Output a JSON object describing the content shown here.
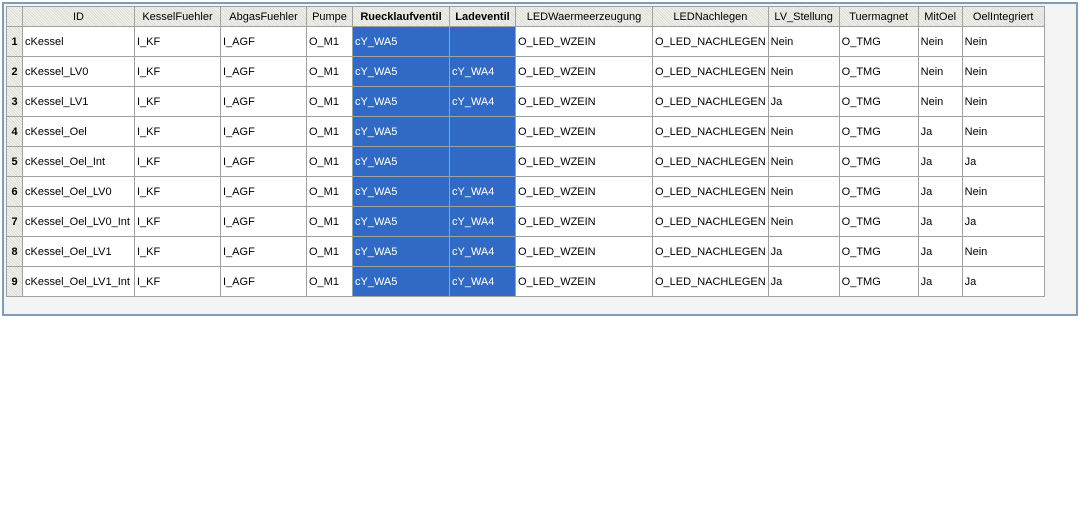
{
  "grid": {
    "columns": [
      "ID",
      "KesselFuehler",
      "AbgasFuehler",
      "Pumpe",
      "Ruecklaufventil",
      "Ladeventil",
      "LEDWaermeerzeugung",
      "LEDNachlegen",
      "LV_Stellung",
      "Tuermagnet",
      "MitOel",
      "OelIntegriert"
    ],
    "rows": [
      {
        "num": "1",
        "cells": [
          "cKessel",
          "I_KF",
          "I_AGF",
          "O_M1",
          "cY_WA5",
          "",
          "O_LED_WZEIN",
          "O_LED_NACHLEGEN",
          "Nein",
          "O_TMG",
          "Nein",
          "Nein"
        ]
      },
      {
        "num": "2",
        "cells": [
          "cKessel_LV0",
          "I_KF",
          "I_AGF",
          "O_M1",
          "cY_WA5",
          "cY_WA4",
          "O_LED_WZEIN",
          "O_LED_NACHLEGEN",
          "Nein",
          "O_TMG",
          "Nein",
          "Nein"
        ]
      },
      {
        "num": "3",
        "cells": [
          "cKessel_LV1",
          "I_KF",
          "I_AGF",
          "O_M1",
          "cY_WA5",
          "cY_WA4",
          "O_LED_WZEIN",
          "O_LED_NACHLEGEN",
          "Ja",
          "O_TMG",
          "Nein",
          "Nein"
        ]
      },
      {
        "num": "4",
        "cells": [
          "cKessel_Oel",
          "I_KF",
          "I_AGF",
          "O_M1",
          "cY_WA5",
          "",
          "O_LED_WZEIN",
          "O_LED_NACHLEGEN",
          "Nein",
          "O_TMG",
          "Ja",
          "Nein"
        ]
      },
      {
        "num": "5",
        "cells": [
          "cKessel_Oel_Int",
          "I_KF",
          "I_AGF",
          "O_M1",
          "cY_WA5",
          "",
          "O_LED_WZEIN",
          "O_LED_NACHLEGEN",
          "Nein",
          "O_TMG",
          "Ja",
          "Ja"
        ]
      },
      {
        "num": "6",
        "cells": [
          "cKessel_Oel_LV0",
          "I_KF",
          "I_AGF",
          "O_M1",
          "cY_WA5",
          "cY_WA4",
          "O_LED_WZEIN",
          "O_LED_NACHLEGEN",
          "Nein",
          "O_TMG",
          "Ja",
          "Nein"
        ]
      },
      {
        "num": "7",
        "cells": [
          "cKessel_Oel_LV0_Int",
          "I_KF",
          "I_AGF",
          "O_M1",
          "cY_WA5",
          "cY_WA4",
          "O_LED_WZEIN",
          "O_LED_NACHLEGEN",
          "Nein",
          "O_TMG",
          "Ja",
          "Ja"
        ]
      },
      {
        "num": "8",
        "cells": [
          "cKessel_Oel_LV1",
          "I_KF",
          "I_AGF",
          "O_M1",
          "cY_WA5",
          "cY_WA4",
          "O_LED_WZEIN",
          "O_LED_NACHLEGEN",
          "Ja",
          "O_TMG",
          "Ja",
          "Nein"
        ]
      },
      {
        "num": "9",
        "cells": [
          "cKessel_Oel_LV1_Int",
          "I_KF",
          "I_AGF",
          "O_M1",
          "cY_WA5",
          "cY_WA4",
          "O_LED_WZEIN",
          "O_LED_NACHLEGEN",
          "Ja",
          "O_TMG",
          "Ja",
          "Ja"
        ]
      }
    ],
    "selected_columns": [
      "Ruecklaufventil",
      "Ladeventil"
    ],
    "selection_color": "#316ac5"
  }
}
